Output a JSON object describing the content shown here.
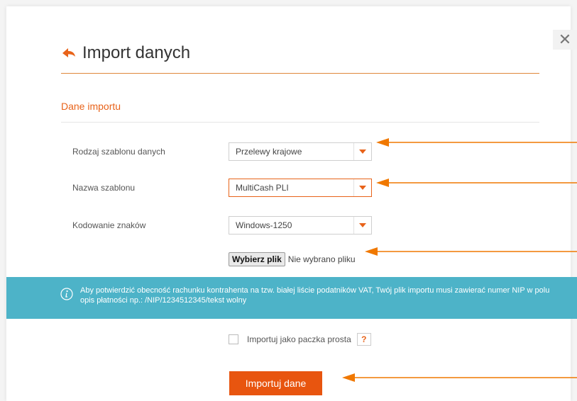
{
  "modal": {
    "title": "Import danych",
    "close_label": "✕",
    "section_title": "Dane importu"
  },
  "form": {
    "template_type": {
      "label": "Rodzaj szablonu danych",
      "value": "Przelewy krajowe"
    },
    "template_name": {
      "label": "Nazwa szablonu",
      "value": "MultiCash PLI"
    },
    "encoding": {
      "label": "Kodowanie znaków",
      "value": "Windows-1250"
    },
    "file": {
      "button_label": "Wybierz plik",
      "status": "Nie wybrano pliku"
    }
  },
  "info": {
    "text": "Aby potwierdzić obecność rachunku kontrahenta na tzw. białej liście podatników VAT, Twój plik importu musi zawierać numer NIP w polu opis płatności np.: /NIP/1234512345/tekst wolny"
  },
  "options": {
    "simple_package_label": "Importuj jako paczka prosta",
    "simple_package_checked": false,
    "help_label": "?"
  },
  "actions": {
    "submit_label": "Importuj dane"
  },
  "colors": {
    "accent": "#e8631a",
    "info_bg": "#4db3c8",
    "submit_bg": "#e8550f"
  },
  "icons": {
    "back": "back-arrow-icon",
    "close": "close-icon",
    "dropdown": "chevron-down-icon",
    "info": "info-icon",
    "annotation": "annotation-arrow-icon"
  }
}
